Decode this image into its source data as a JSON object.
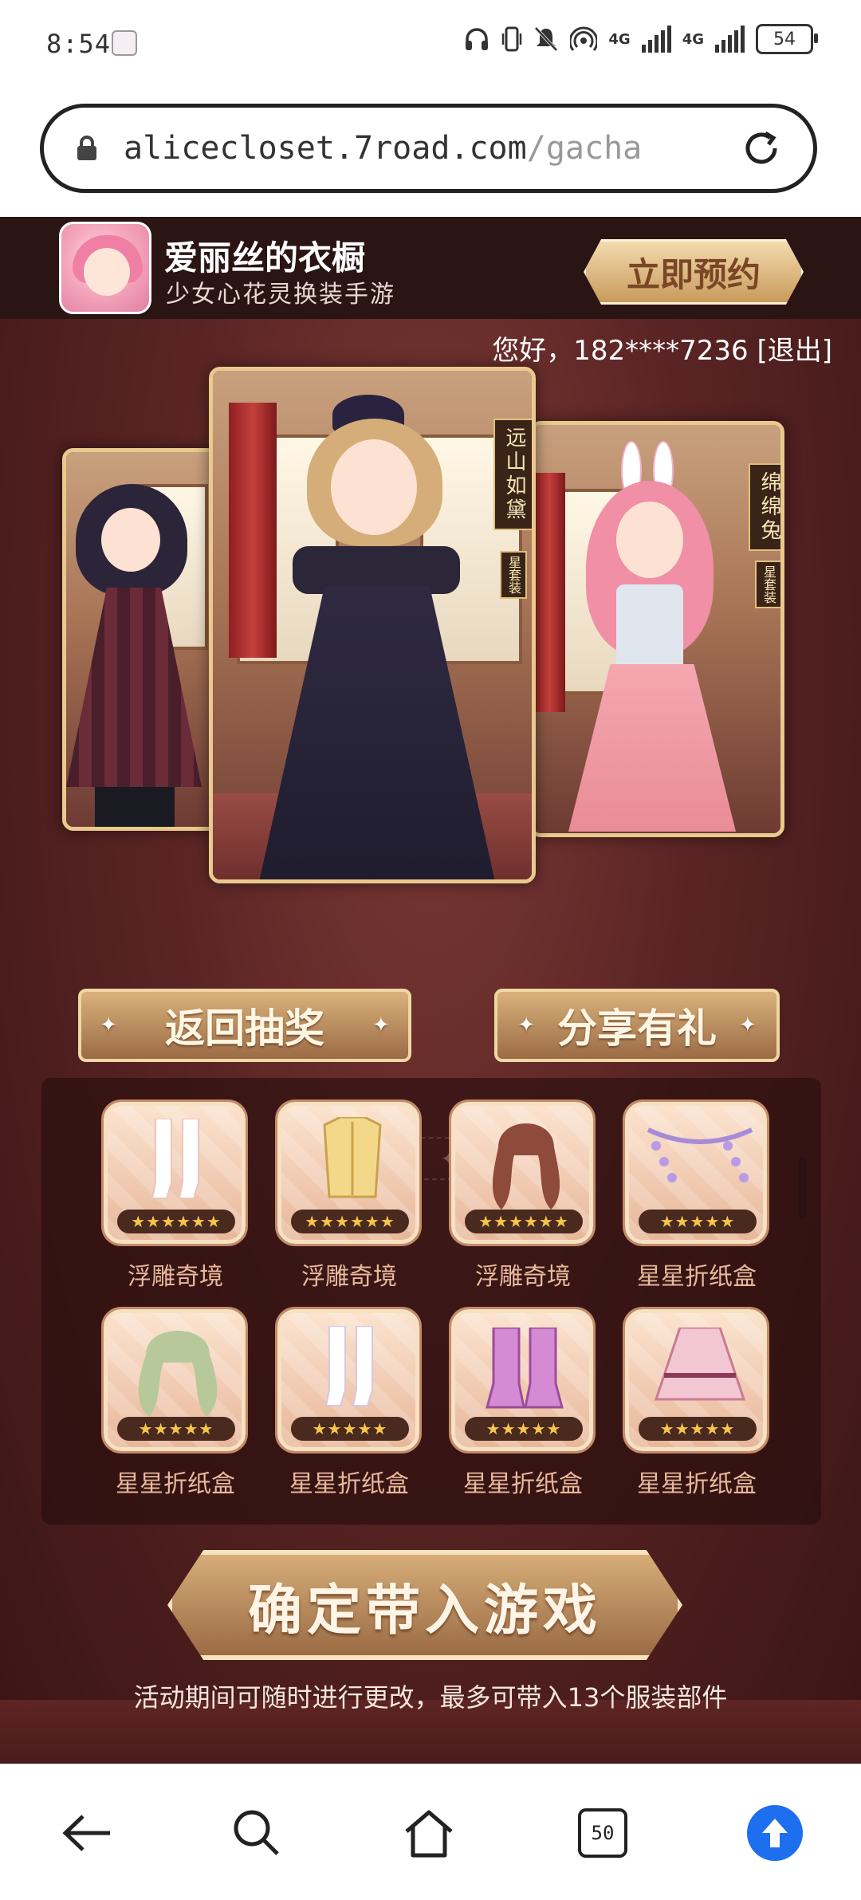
{
  "status_bar": {
    "time": "8:54",
    "network_1": "4G",
    "network_2": "4G",
    "battery": "54",
    "icons": [
      "headphones-icon",
      "vibrate-icon",
      "mute-icon",
      "hotspot-icon",
      "signal-icon",
      "battery-icon"
    ]
  },
  "browser": {
    "url_host": "alicecloset.7road.com",
    "url_path": "/gacha",
    "tab_count": "50"
  },
  "header": {
    "app_name": "爱丽丝的衣橱",
    "app_desc": "少女心花灵换装手游",
    "reserve_button": "立即预约"
  },
  "user": {
    "greeting": "您好，182****7236 [退出]"
  },
  "carousel": {
    "cards": [
      {
        "name": "",
        "tag": ""
      },
      {
        "name": "远山如黛",
        "tag": "星套装"
      },
      {
        "name": "绵绵兔",
        "tag": "星套装"
      }
    ],
    "indicator": [
      "✦",
      "✦",
      "✦",
      "✦",
      "✦",
      "✦"
    ]
  },
  "actions": {
    "back_lottery": "返回抽奖",
    "share_gift": "分享有礼",
    "confirm": "确定带入游戏",
    "notice": "活动期间可随时进行更改，最多可带入13个服装部件"
  },
  "rewards": [
    {
      "label": "浮雕奇境",
      "stars": "★★★★★★",
      "item": "socks"
    },
    {
      "label": "浮雕奇境",
      "stars": "★★★★★★",
      "item": "corset"
    },
    {
      "label": "浮雕奇境",
      "stars": "★★★★★★",
      "item": "hair"
    },
    {
      "label": "星星折纸盒",
      "stars": "★★★★★",
      "item": "headpiece"
    },
    {
      "label": "星星折纸盒",
      "stars": "★★★★★",
      "item": "hair"
    },
    {
      "label": "星星折纸盒",
      "stars": "★★★★★",
      "item": "socks"
    },
    {
      "label": "星星折纸盒",
      "stars": "★★★★★",
      "item": "boots"
    },
    {
      "label": "星星折纸盒",
      "stars": "★★★★★",
      "item": "skirt"
    }
  ],
  "colors": {
    "page_bg": "#5a2424",
    "gold": "#d9b27b",
    "browser_accent": "#1e6ff0"
  }
}
